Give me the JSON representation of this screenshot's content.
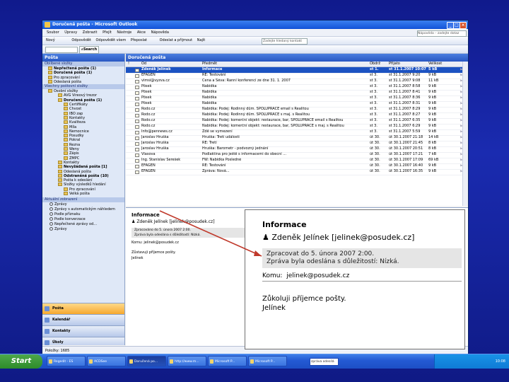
{
  "window": {
    "title": "Doručená pošta - Microsoft Outlook",
    "menu": [
      "Soubor",
      "Úpravy",
      "Zobrazit",
      "Přejít",
      "Nástroje",
      "Akce",
      "Nápověda"
    ],
    "help_box": "Nápověda – zadejte dotaz",
    "toolbar": [
      "Nový",
      "Odpovědět",
      "Odpovědět všem",
      "Přeposlat",
      "Odeslat a přijmout",
      "Najít"
    ],
    "search_placeholder": "Zadejte hledaný kontakt",
    "search_label": "Search"
  },
  "nav": {
    "header": "Pošta",
    "favorites_label": "Oblíbené složky",
    "favorites": [
      {
        "label": "Nepřečtená pošta",
        "count": "(1)",
        "bold": true
      },
      {
        "label": "Doručená pošta",
        "count": "(1)",
        "bold": true
      },
      {
        "label": "Pro zpracování",
        "count": "",
        "bold": false
      },
      {
        "label": "Odeslaná pošta",
        "count": "",
        "bold": false
      }
    ],
    "all_folders_label": "Všechny poštovní složky",
    "folders": [
      {
        "label": "Osobní složky",
        "level": 0
      },
      {
        "label": "AVG Vireový trezor",
        "level": 1
      },
      {
        "label": "Doručená pošta (1)",
        "level": 1,
        "bold": true
      },
      {
        "label": "Certifikáty",
        "level": 2
      },
      {
        "label": "Chvost",
        "level": 2
      },
      {
        "label": "IBO zap",
        "level": 2
      },
      {
        "label": "Kontakty",
        "level": 2
      },
      {
        "label": "Kvaliteza",
        "level": 2
      },
      {
        "label": "Míla",
        "level": 2
      },
      {
        "label": "Nemocnice",
        "level": 2
      },
      {
        "label": "Posudky",
        "level": 2
      },
      {
        "label": "Pokral",
        "level": 2
      },
      {
        "label": "Rezna",
        "level": 2
      },
      {
        "label": "Weny",
        "level": 2
      },
      {
        "label": "Zápis",
        "level": 2
      },
      {
        "label": "ZMPC",
        "level": 2
      },
      {
        "label": "Kontakty",
        "level": 1
      },
      {
        "label": "Nevyžádaná pošta [1]",
        "level": 1,
        "bold": true
      },
      {
        "label": "Odeslaná pošta",
        "level": 1
      },
      {
        "label": "Odstraněná pošta (10)",
        "level": 1,
        "bold": true
      },
      {
        "label": "Pošta k odeslání",
        "level": 1
      },
      {
        "label": "Složky výsledků hledání",
        "level": 1
      },
      {
        "label": "Pro zpracování",
        "level": 2
      },
      {
        "label": "Velká pošta",
        "level": 2
      }
    ],
    "view_label": "Aktuální zobrazení",
    "views": [
      "Zprávy",
      "Zprávy s automatickým náhledem",
      "Podle příznaku",
      "Podle konverzace",
      "Nepřečtené zprávy od...",
      "Zprávy"
    ],
    "buttons": [
      {
        "label": "Pošta",
        "active": true
      },
      {
        "label": "Kalendář",
        "active": false
      },
      {
        "label": "Kontakty",
        "active": false
      },
      {
        "label": "Úkoly",
        "active": false
      }
    ]
  },
  "list": {
    "header": "Doručená pošta",
    "columns": [
      "!",
      "Od",
      "Předmět",
      "Obdrž",
      "Přijato",
      "Velikost"
    ],
    "rows": [
      {
        "from": "Zdeněk Jelínek",
        "subject": "Informace",
        "recv": "st 1.",
        "date": "st 31.1.2007 10:07",
        "size": "5 kB",
        "sel": true
      },
      {
        "from": "EFAGEN",
        "subject": "RE: Testování",
        "recv": "st 3.",
        "date": "st 31.1.2007 9:20",
        "size": "9 kB"
      },
      {
        "from": "vimsi@vyzva.cz",
        "subject": "Cena a Šéva: Ranní konferenci ze dne 31. 1. 2007",
        "recv": "st 3.",
        "date": "st 31.1.2007 9:08",
        "size": "11 kB"
      },
      {
        "from": "Pösek",
        "subject": "Nabídka",
        "recv": "st 3.",
        "date": "st 31.1.2007 8:58",
        "size": "9 kB"
      },
      {
        "from": "Pösek",
        "subject": "Nabídka",
        "recv": "st 3.",
        "date": "st 31.1.2007 8:41",
        "size": "9 kB"
      },
      {
        "from": "Pösek",
        "subject": "Nabídka",
        "recv": "st 3.",
        "date": "st 31.1.2007 8:36",
        "size": "9 kB"
      },
      {
        "from": "Pösek",
        "subject": "Nabídka",
        "recv": "st 3.",
        "date": "st 31.1.2007 8:31",
        "size": "9 kB"
      },
      {
        "from": "Rodo.cz",
        "subject": "Nabídka: Podej: Rodinný dům. SPOLUPRÁCE email s Realitou",
        "recv": "st 3.",
        "date": "st 31.1.2007 8:29",
        "size": "9 kB"
      },
      {
        "from": "Rodo.cz",
        "subject": "Nabídka: Podej: Rodinný dům. SPOLUPRÁCE s maj. s Realitou",
        "recv": "st 3.",
        "date": "st 31.1.2007 8:27",
        "size": "9 kB"
      },
      {
        "from": "Rodo.cz",
        "subject": "Nabídka: Podej: komerční objekt: restaurace, bar, SPOLUPRÁCE email s Realitou",
        "recv": "st 3.",
        "date": "st 31.1.2007 6:35",
        "size": "9 kB"
      },
      {
        "from": "Rodo.cz",
        "subject": "Nabídka: Podej: komerční objekt: restaurace, bar, SPOLUPRÁCE s maj. s Realitou",
        "recv": "st 3.",
        "date": "st 31.1.2007 6:29",
        "size": "9 kB"
      },
      {
        "from": "Info@pennews.cz",
        "subject": "Zdě se vymezení",
        "recv": "st 3.",
        "date": "st 31.1.2007 5:59",
        "size": "9 kB"
      },
      {
        "from": "Jaroslav Hruška",
        "subject": "Hruška: Tretí události",
        "recv": "út 30.",
        "date": "út 30.1.2007 21:18",
        "size": "14 kB"
      },
      {
        "from": "Jaroslav Hruška",
        "subject": "RE: Tretí",
        "recv": "út 30.",
        "date": "út 30.1.2007 21:45",
        "size": "8 kB"
      },
      {
        "from": "Jaroslav Hruška",
        "subject": "Hruška: Barometr - podvozný jednání",
        "recv": "út 30.",
        "date": "út 30.1.2007 20:51",
        "size": "8 kB"
      },
      {
        "from": "Vlasova",
        "subject": "Podlaktina pro ještě s informacemi do obecní ...",
        "recv": "út 30.",
        "date": "út 30.1.2007 17:21",
        "size": "7 kB"
      },
      {
        "from": "Ing. Stanislav Šerešek",
        "subject": "FW: Nabídka Posledné",
        "recv": "út 30.",
        "date": "út 30.1.2007 17:09",
        "size": "69 kB"
      },
      {
        "from": "EFAGEN",
        "subject": "RE: Testování",
        "recv": "út 30.",
        "date": "út 30.1.2007 16:40",
        "size": "9 kB"
      },
      {
        "from": "EFAGEN",
        "subject": "Zpráva: Nová...",
        "recv": "út 30.",
        "date": "út 30.1.2007 16:35",
        "size": "9 kB"
      }
    ]
  },
  "reading": {
    "title": "Informace",
    "from": "Zdeněk Jelínek [jelinek@posudek.cz]",
    "info1": "Zpracováno do 5. února 2007 2:00.",
    "info2": "Zpráva byla odeslána s důležitostí: Nízká.",
    "to_label": "Komu:",
    "to": "jelinek@posudek.cz",
    "body1": "Zůstavuji příjemce pošty.",
    "body2": "Jelínek"
  },
  "zoom": {
    "title": "Informace",
    "from": "Zdeněk Jelínek [jelinek@posudek.cz]",
    "info1": "Zpracovat do 5. února 2007 2:00.",
    "info2": "Zpráva byla odeslána s důležitostí: Nízká.",
    "to_label": "Komu:",
    "to": "jelinek@posudek.cz",
    "body1": "Zůkoluji příjemce pošty.",
    "body2": "Jelínek"
  },
  "status": {
    "items": "Položky: 1685"
  },
  "taskbar": {
    "start": "Start",
    "items": [
      {
        "label": "Regedit - ES",
        "active": false
      },
      {
        "label": "ACDSee",
        "active": false
      },
      {
        "label": "Doručená po...",
        "active": true
      },
      {
        "label": "http://www.m...",
        "active": false
      },
      {
        "label": "Microsoft P...",
        "active": false
      },
      {
        "label": "Microsoft P...",
        "active": false
      }
    ],
    "address": "zpráva odesílá",
    "clock": "10:08"
  },
  "colors": {
    "accent": "#1b52c2",
    "arrow": "#c0392b",
    "desktop": "#1a2bb0"
  }
}
